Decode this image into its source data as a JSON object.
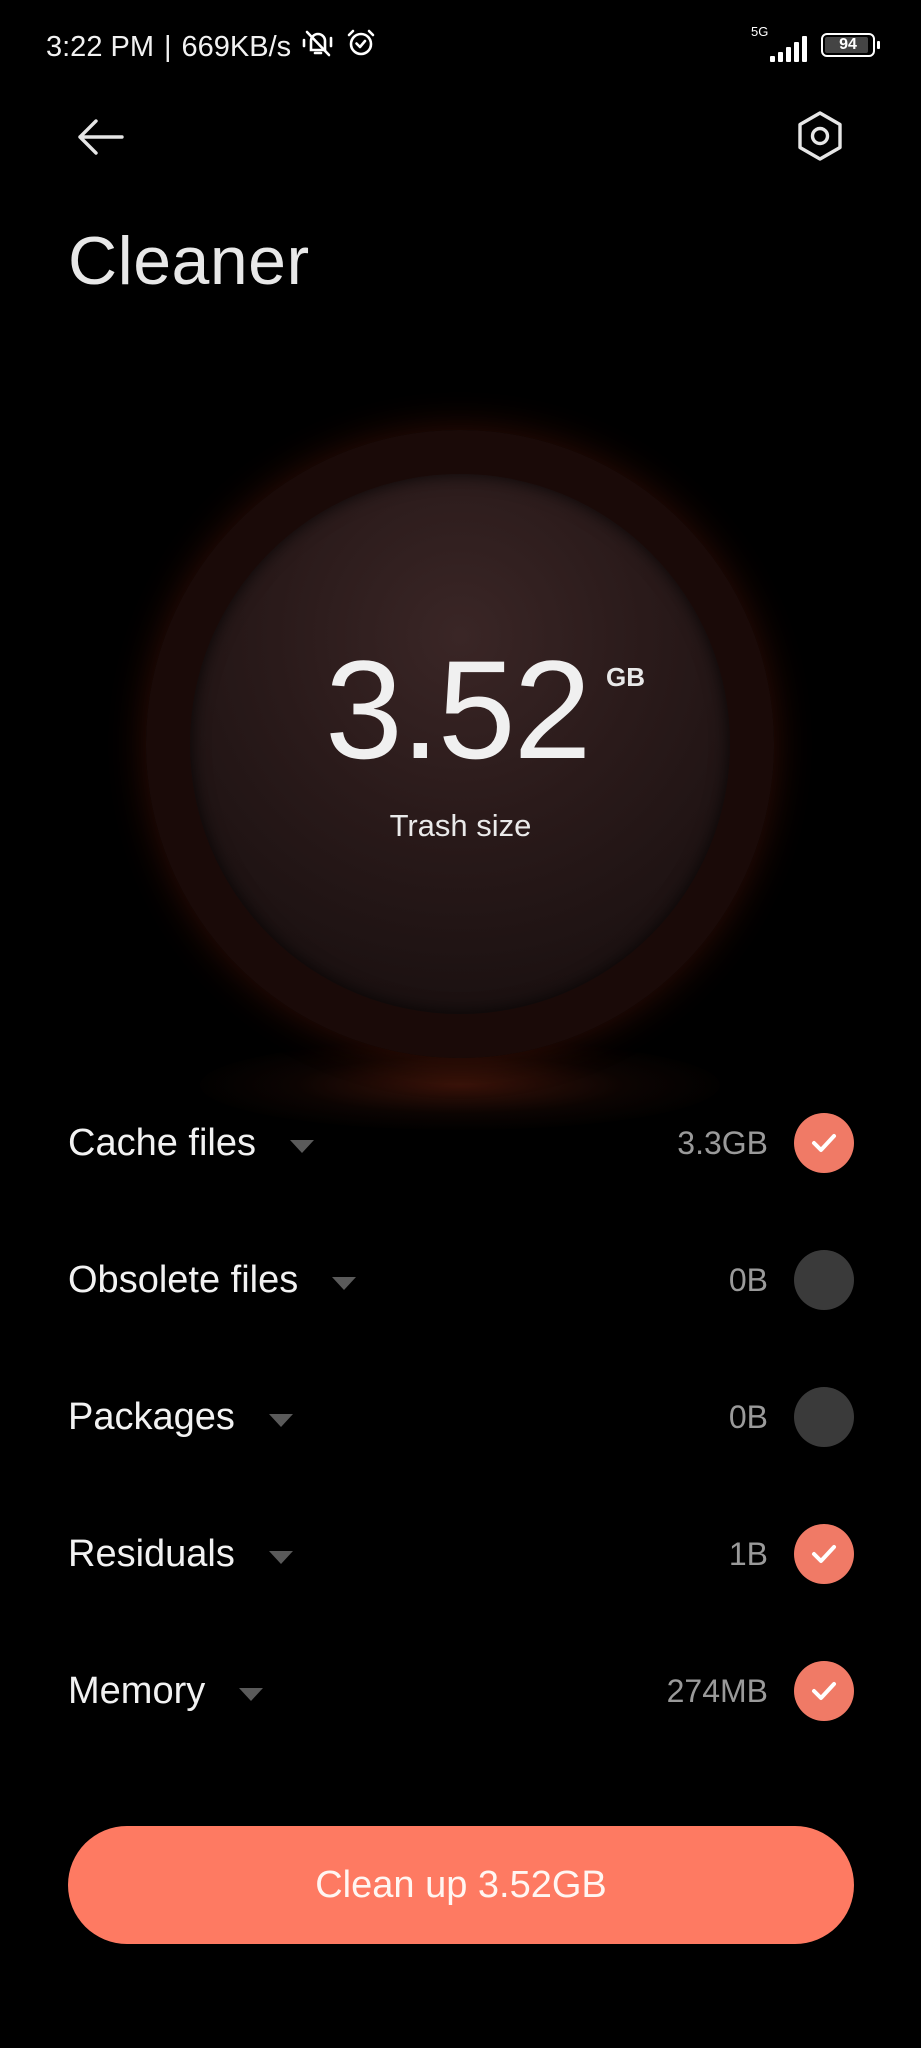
{
  "status_bar": {
    "time": "3:22 PM",
    "separator": "|",
    "network_speed": "669KB/s",
    "icons": [
      "bell-muted-icon",
      "alarm-icon",
      "signal-5g-icon",
      "battery-icon"
    ],
    "network_type": "5G",
    "battery_level": "94"
  },
  "header": {
    "back_icon": "arrow-left-icon",
    "settings_icon": "settings-hexagon-icon",
    "title": "Cleaner"
  },
  "summary": {
    "value": "3.52",
    "unit": "GB",
    "label": "Trash size"
  },
  "categories": [
    {
      "label": "Cache files",
      "size": "3.3GB",
      "checked": true
    },
    {
      "label": "Obsolete files",
      "size": "0B",
      "checked": false
    },
    {
      "label": "Packages",
      "size": "0B",
      "checked": false
    },
    {
      "label": "Residuals",
      "size": "1B",
      "checked": true
    },
    {
      "label": "Memory",
      "size": "274MB",
      "checked": true
    }
  ],
  "action": {
    "label": "Clean up 3.52GB"
  },
  "colors": {
    "accent": "#fe7a62",
    "check_on": "#f07a66",
    "check_off": "#3a3a3a",
    "ring": "#e0432a",
    "background": "#000000"
  }
}
